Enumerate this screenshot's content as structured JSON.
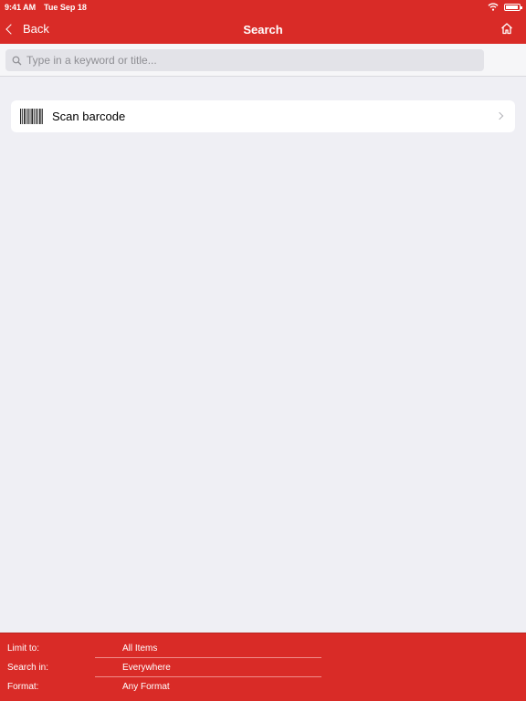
{
  "status_bar": {
    "time": "9:41 AM",
    "date": "Tue Sep 18"
  },
  "nav": {
    "back_label": "Back",
    "title": "Search"
  },
  "search": {
    "placeholder": "Type in a keyword or title..."
  },
  "scan_row": {
    "label": "Scan barcode"
  },
  "filters": [
    {
      "label": "Limit to:",
      "value": "All Items"
    },
    {
      "label": "Search in:",
      "value": "Everywhere"
    },
    {
      "label": "Format:",
      "value": "Any Format"
    }
  ],
  "colors": {
    "accent": "#d92b27",
    "background": "#efeff4",
    "search_field": "#e3e3e8"
  },
  "icons": [
    "back-chevron-icon",
    "home-icon",
    "wifi-icon",
    "battery-icon",
    "search-icon",
    "barcode-icon",
    "disclosure-chevron-icon"
  ]
}
